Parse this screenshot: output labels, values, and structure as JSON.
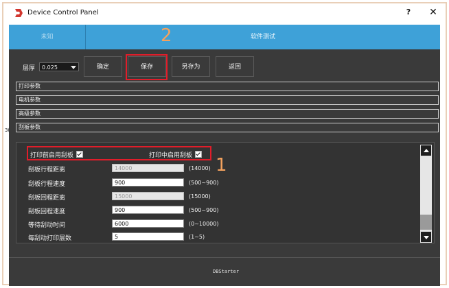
{
  "window": {
    "title": "Device Control Panel",
    "help": "?",
    "close": "✕"
  },
  "tabs": [
    {
      "label": "未知"
    },
    {
      "label": "软件测试"
    }
  ],
  "annotations": {
    "num1": "1",
    "num2": "2"
  },
  "toolbar": {
    "layer_label": "层厚",
    "layer_value": "0.025",
    "confirm_label": "确定",
    "save_label": "保存",
    "save_as_label": "另存为",
    "back_label": "返回"
  },
  "sections": [
    {
      "label": "打印参数"
    },
    {
      "label": "电机参数"
    },
    {
      "label": "高级参数"
    },
    {
      "label": "刮板参数"
    }
  ],
  "options": {
    "pre_print_scraper": "打印前启用刮板",
    "in_print_scraper": "打印中启用刮板"
  },
  "params": [
    {
      "label": "刮板行程距离",
      "value": "14000",
      "range": "(14000)",
      "enabled": false
    },
    {
      "label": "刮板行程速度",
      "value": "900",
      "range": "(500~900)",
      "enabled": true
    },
    {
      "label": "刮板回程距离",
      "value": "15000",
      "range": "(15000)",
      "enabled": false
    },
    {
      "label": "刮板回程速度",
      "value": "900",
      "range": "(500~900)",
      "enabled": true
    },
    {
      "label": "等待刮动时间",
      "value": "6000",
      "range": "(0~10000)",
      "enabled": true
    },
    {
      "label": "每刮动打印层数",
      "value": "5",
      "range": "(1~5)",
      "enabled": true
    }
  ],
  "status": {
    "text": "DBStarter"
  },
  "side_mark": "3(",
  "colors": {
    "tab_blue": "#3ea1d8",
    "panel_dark": "#3a3a3a",
    "highlight_red": "#e11d2a",
    "annotation_orange": "#f4a25e"
  }
}
